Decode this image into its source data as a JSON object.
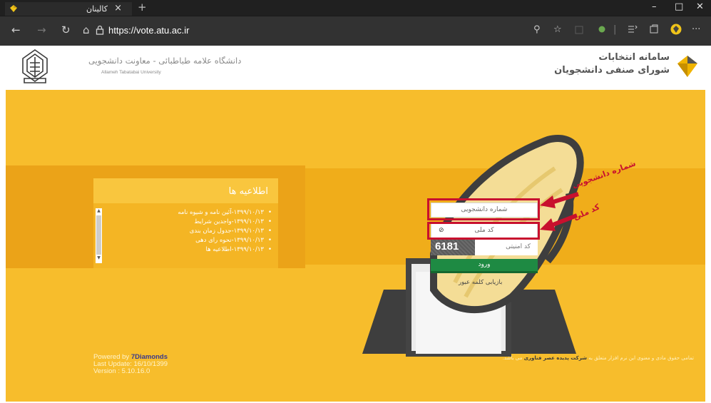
{
  "browser": {
    "tab_title": "کالینان",
    "tab_close": "×",
    "new_tab": "+",
    "url": "https://vote.atu.ac.ir",
    "window": {
      "minimize": "–",
      "maximize": "□",
      "close": "✕"
    },
    "nav": {
      "back": "←",
      "forward": "→",
      "refresh": "↻",
      "home": "⌂"
    },
    "toolbar": {
      "zoom": "⚲",
      "favorite": "☆",
      "more": "···"
    }
  },
  "header": {
    "university_name": "دانشگاه علامه طباطبائی - معاونت دانشجویی",
    "university_name_en": "Allameh Tabatabai University",
    "system_title_line1": "سامانه انتخابات",
    "system_title_line2": "شورای صنفی دانشجویان"
  },
  "news": {
    "title": "اطلاعیه ها",
    "items": [
      "۱۳۹۹/۱۰/۱۳-آئین نامه و شیوه نامه",
      "۱۳۹۹/۱۰/۱۳-واجدین شرایط",
      "۱۳۹۹/۱۰/۱۳-جدول زمان بندی",
      "۱۳۹۹/۱۰/۱۳-نحوه رای دهی",
      "۱۳۹۹/۱۰/۱۳-اطلاعیه ها"
    ],
    "scroll_up": "▲",
    "scroll_down": "▼"
  },
  "login": {
    "student_number_placeholder": "شماره دانشجویی",
    "national_code_placeholder": "کد ملی",
    "captcha_text": "6181",
    "captcha_label": "کد امنیتی",
    "login_button": "ورود",
    "recover_link": "بازیابی کلمه عبور",
    "eye_icon": "⊘"
  },
  "annotations": {
    "student_number": "شماره دانشجویی",
    "national_code": "کد ملی"
  },
  "footer": {
    "powered_by_prefix": "Powered by ",
    "powered_by_brand": "7Diamonds",
    "last_update": "Last Update: 16/10/1399",
    "version": "Version : 5.10.16.0",
    "copyright_prefix": "تمامی حقوق مادی و معنوی این نرم افزار متعلق به ",
    "copyright_company": "شرکت پدیده عصر فناوری",
    "copyright_suffix": " می باشد."
  },
  "colors": {
    "background_yellow": "#f7bd2c",
    "button_green": "#1e8a43",
    "highlight_red": "#c8102e"
  }
}
